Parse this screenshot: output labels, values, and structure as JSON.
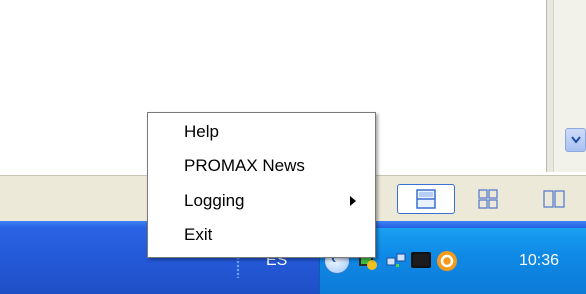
{
  "menu": {
    "items": [
      {
        "label": "Help"
      },
      {
        "label": "PROMAX News"
      },
      {
        "label": "Logging",
        "has_submenu": true
      },
      {
        "label": "Exit"
      }
    ]
  },
  "taskbar": {
    "language": "ES",
    "clock": "10:36",
    "tray_icons": [
      "show-hidden-icons-chevron",
      "app-green-icon",
      "network-icon",
      "monitor-icon",
      "orange-app-icon"
    ]
  },
  "status_bar": {
    "view_buttons": [
      "single-view-icon",
      "grid-view-icon",
      "dual-view-icon"
    ]
  },
  "colors": {
    "taskbar": "#2459d8",
    "tray": "#0f8ae6",
    "status_band": "#ece9d8",
    "menu_bg": "#ffffff"
  }
}
